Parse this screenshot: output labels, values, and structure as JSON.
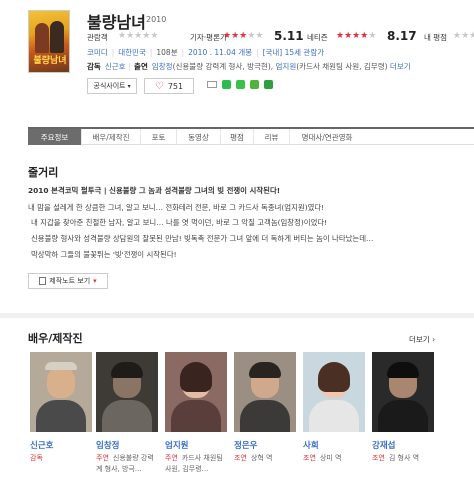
{
  "movie": {
    "title": "불량남녀",
    "year": "2010",
    "poster_text": "불량남녀"
  },
  "ratings": {
    "audience_label": "관람객",
    "audience_stars": 0,
    "critic_label": "기자·평론가",
    "critic_stars": 2.5,
    "critic_score": "5.11",
    "netizen_label": "네티즌",
    "netizen_stars": 4,
    "netizen_score": "8.17",
    "my_label": "내 평점"
  },
  "meta": {
    "genre": "코미디",
    "country": "대한민국",
    "runtime": "108분",
    "release": "2010 . 11.04 개봉",
    "grade": "[국내] 15세 관람가"
  },
  "crew": {
    "director_label": "감독",
    "director": "신근호",
    "cast_label": "출연",
    "cast_1": "임창정",
    "cast_1_role": "(신용불량 강력계 형사, 방극현)",
    "cast_2": "엄지원",
    "cast_2_role": "(카드사 채원팀 사원, 김무령)",
    "more": "더보기"
  },
  "buttons": {
    "official": "공식사이트",
    "like_count": "751",
    "note": "제작노트 보기"
  },
  "tabs": [
    "주요정보",
    "배우/제작진",
    "포토",
    "동영상",
    "평점",
    "리뷰",
    "명대사/연관영화"
  ],
  "story": {
    "heading": "줄거리",
    "headline": "2010 본격코믹 펄투극 | 신용불량 그 놈과 성격불량 그녀의 빚 전쟁이 시작된다!",
    "lines": [
      "내 맘을 설레게 한 상큼한 그녀, 알고 보니… 전화테러 전문, 바로 그 카드사 독종녀(엄지원)였다!",
      "내 지갑을 찾아준 친절한 남자, 알고 보니… 나를 엿 먹이던, 바로 그 악질 고객놈(임창정)이었다!",
      "신용불량 형사와 성격불량 상담원의 잘못된 만남! 빚독촉 전문가 그녀 앞에 더 독하게 버티는 놈이 나타났는데…",
      "막상막하 그들의 불꽃튀는 '빚'전쟁이 시작된다!"
    ]
  },
  "cast_section": {
    "heading": "배우/제작진",
    "more": "더보기",
    "people": [
      {
        "name": "신근호",
        "kind": "감독",
        "role": ""
      },
      {
        "name": "임창정",
        "kind": "주연",
        "role": "신용불량 강력계 형사, 방극..."
      },
      {
        "name": "엄지원",
        "kind": "주연",
        "role": "카드사 채원팀 사원, 김무령..."
      },
      {
        "name": "정은우",
        "kind": "조연",
        "role": "상혁 역"
      },
      {
        "name": "사희",
        "kind": "조연",
        "role": "상미 역"
      },
      {
        "name": "강재섭",
        "kind": "조연",
        "role": "김 형사 역"
      }
    ]
  },
  "colors": {
    "accent_red": "#e0303a",
    "link_blue": "#3a6fc4",
    "tab_active": "#6c6c6c"
  }
}
